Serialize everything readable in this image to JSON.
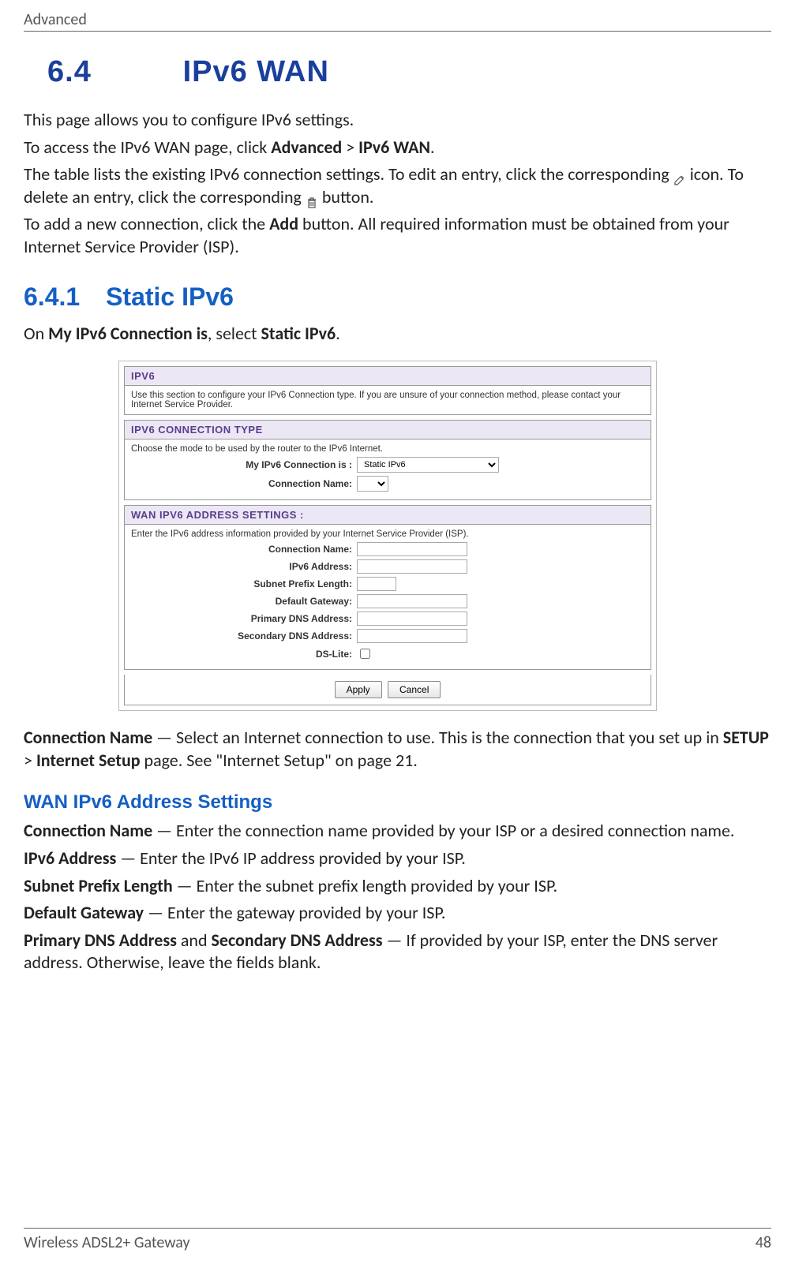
{
  "header": {
    "breadcrumb": "Advanced"
  },
  "section": {
    "number": "6.4",
    "title": "IPv6 WAN",
    "intro1": "This page allows you to configure IPv6 settings.",
    "intro2a": "To access the IPv6 WAN page, click ",
    "intro2_bold1": "Advanced",
    "intro2_sep": " > ",
    "intro2_bold2": "IPv6 WAN",
    "intro2b": ".",
    "intro3a": "The table lists the existing IPv6 connection settings. To edit an entry, click the corresponding ",
    "intro3b": " icon. To delete an entry, click the corresponding ",
    "intro3c": " button.",
    "intro4a": "To add a new connection, click the ",
    "intro4_bold": "Add",
    "intro4b": " button. All required information must be obtained from your Internet Service Provider (ISP)."
  },
  "subsection": {
    "number": "6.4.1",
    "title": "Static IPv6",
    "lead_a": "On ",
    "lead_b1": "My IPv6 Connection is",
    "lead_mid": ", select ",
    "lead_b2": "Static IPv6",
    "lead_end": "."
  },
  "panel": {
    "ipv6": {
      "title": "IPV6",
      "desc": "Use this section to configure your IPv6 Connection type. If you are unsure of your connection method, please contact your Internet Service Provider."
    },
    "conn_type": {
      "title": "IPV6 CONNECTION TYPE",
      "desc": "Choose the mode to be used by the router to the IPv6 Internet.",
      "my_conn_label": "My IPv6 Connection is :",
      "my_conn_value": "Static IPv6",
      "conn_name_label": "Connection Name:"
    },
    "wan": {
      "title": "WAN IPV6 ADDRESS SETTINGS :",
      "desc": "Enter the IPv6 address information provided by your Internet Service Provider (ISP).",
      "conn_name": "Connection Name:",
      "ipv6_addr": "IPv6 Address:",
      "prefix": "Subnet Prefix Length:",
      "gateway": "Default Gateway:",
      "primary_dns": "Primary DNS Address:",
      "secondary_dns": "Secondary DNS Address:",
      "dslite": "DS-Lite:"
    },
    "buttons": {
      "apply": "Apply",
      "cancel": "Cancel"
    }
  },
  "definitions": {
    "conn_name_top": {
      "term": "Connection Name",
      "text_a": " — Select an Internet connection to use. This is the connection that you set up in ",
      "bold1": "SETUP",
      "sep": " > ",
      "bold2": "Internet Setup",
      "text_b": " page. See \"Internet Setup\" on page 21."
    },
    "wan_heading": "WAN IPv6 Address Settings",
    "conn_name2": {
      "term": "Connection Name",
      "text": " — Enter the connection name provided by your ISP or a desired connection name."
    },
    "ipv6_addr": {
      "term": "IPv6 Address",
      "text": " — Enter the IPv6 IP address provided by your ISP."
    },
    "prefix": {
      "term": "Subnet Prefix Length",
      "text": " — Enter the subnet prefix length provided by your ISP."
    },
    "gateway": {
      "term": "Default Gateway",
      "text": " — Enter the gateway provided by your ISP."
    },
    "dns": {
      "term1": "Primary DNS Address",
      "mid": " and ",
      "term2": "Secondary DNS Address",
      "text": " — If provided by your ISP, enter the DNS server address. Otherwise, leave the fields blank."
    }
  },
  "footer": {
    "left": "Wireless ADSL2+ Gateway",
    "right": "48"
  }
}
